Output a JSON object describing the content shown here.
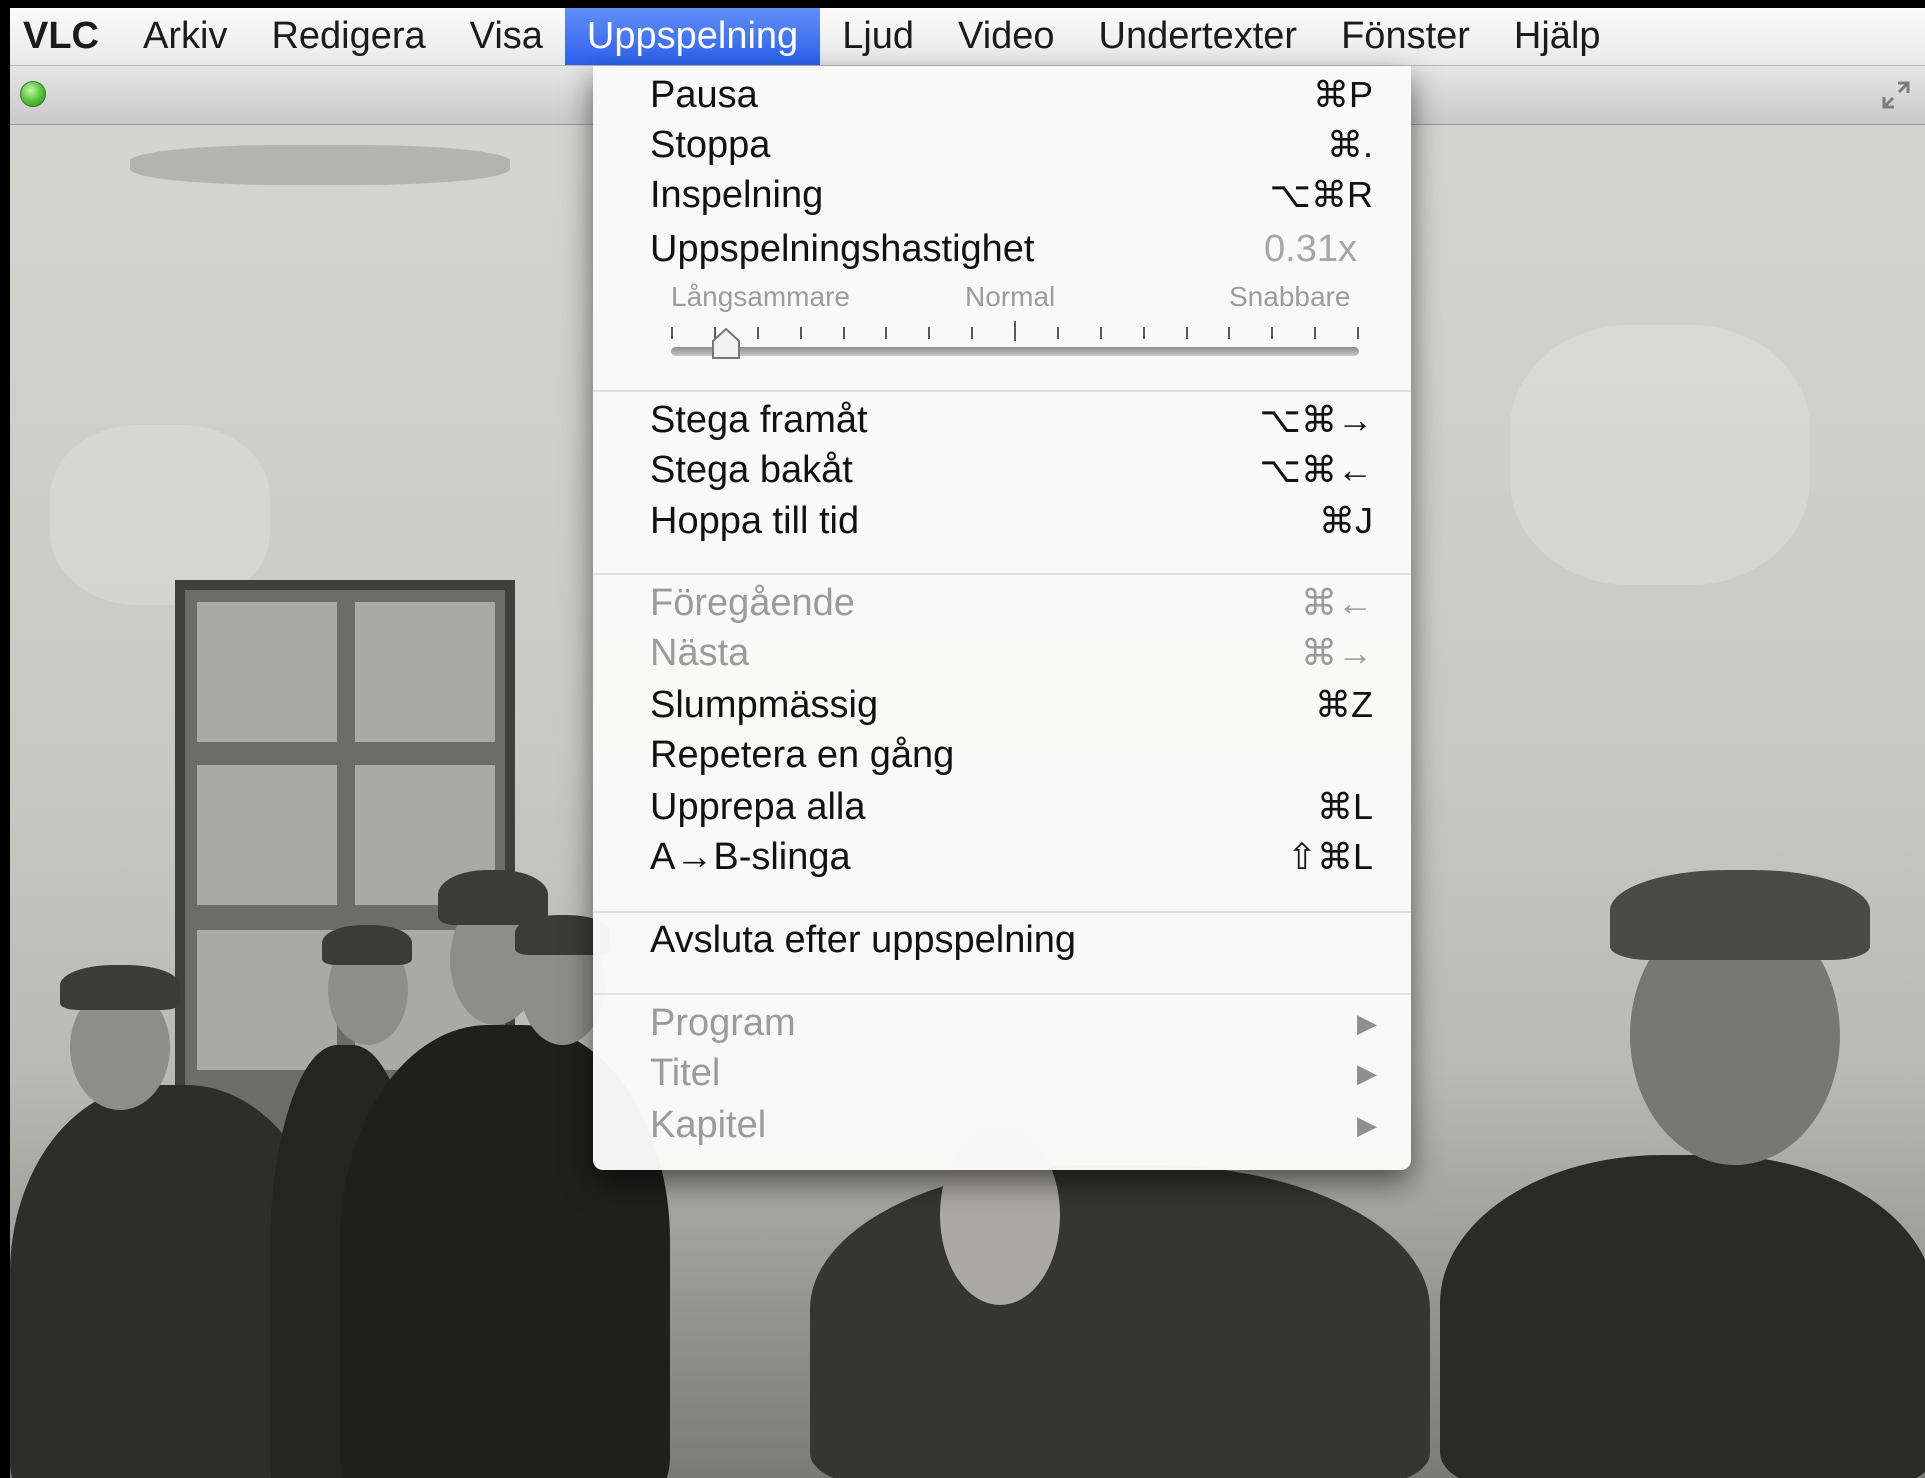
{
  "menubar": {
    "app": "VLC",
    "items": [
      "Arkiv",
      "Redigera",
      "Visa",
      "Uppspelning",
      "Ljud",
      "Video",
      "Undertexter",
      "Fönster",
      "Hjälp"
    ],
    "active": "Uppspelning"
  },
  "window": {
    "icons": {
      "status": "green-circle-icon",
      "fullscreen": "expand-arrows-icon"
    }
  },
  "dropdown": {
    "pause": {
      "label": "Pausa",
      "shortcut": "⌘P"
    },
    "stop": {
      "label": "Stoppa",
      "shortcut": "⌘."
    },
    "record": {
      "label": "Inspelning",
      "shortcut": "⌥⌘R"
    },
    "speed": {
      "label": "Uppspelningshastighet",
      "value": "0.31x",
      "slider_slower": "Långsammare",
      "slider_normal": "Normal",
      "slider_faster": "Snabbare",
      "slider_position": 0.08
    },
    "step_forward": {
      "label": "Stega framåt",
      "shortcut": "⌥⌘→"
    },
    "step_backward": {
      "label": "Stega bakåt",
      "shortcut": "⌥⌘←"
    },
    "jump_to_time": {
      "label": "Hoppa till tid",
      "shortcut": "⌘J"
    },
    "previous": {
      "label": "Föregående",
      "shortcut": "⌘←"
    },
    "next": {
      "label": "Nästa",
      "shortcut": "⌘→"
    },
    "random": {
      "label": "Slumpmässig",
      "shortcut": "⌘Z"
    },
    "repeat_one": {
      "label": "Repetera en gång"
    },
    "repeat_all": {
      "label": "Upprepa alla",
      "shortcut": "⌘L"
    },
    "ab_loop": {
      "label": "A→B-slinga",
      "shortcut": "⇧⌘L"
    },
    "quit_after": {
      "label": "Avsluta efter uppspelning"
    },
    "program": {
      "label": "Program"
    },
    "title": {
      "label": "Titel"
    },
    "chapter": {
      "label": "Kapitel"
    }
  },
  "colors": {
    "menu_highlight": "#3c6ff3",
    "disabled_text": "#9b9b9b"
  }
}
